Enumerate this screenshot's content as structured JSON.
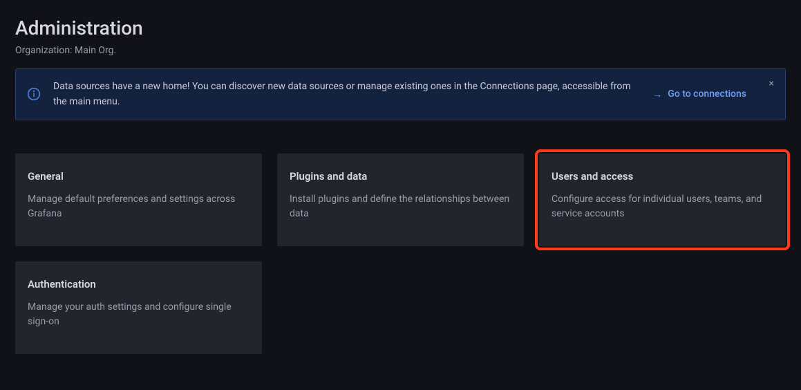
{
  "header": {
    "title": "Administration",
    "subtitle": "Organization: Main Org."
  },
  "alert": {
    "text": "Data sources have a new home! You can discover new data sources or manage existing ones in the Connections page, accessible from the main menu.",
    "link_label": "Go to connections",
    "close_label": "×"
  },
  "cards": [
    {
      "title": "General",
      "desc": "Manage default preferences and settings across Grafana",
      "highlighted": false
    },
    {
      "title": "Plugins and data",
      "desc": "Install plugins and define the relationships between data",
      "highlighted": false
    },
    {
      "title": "Users and access",
      "desc": "Configure access for individual users, teams, and service accounts",
      "highlighted": true
    },
    {
      "title": "Authentication",
      "desc": "Manage your auth settings and configure single sign-on",
      "highlighted": false
    }
  ]
}
